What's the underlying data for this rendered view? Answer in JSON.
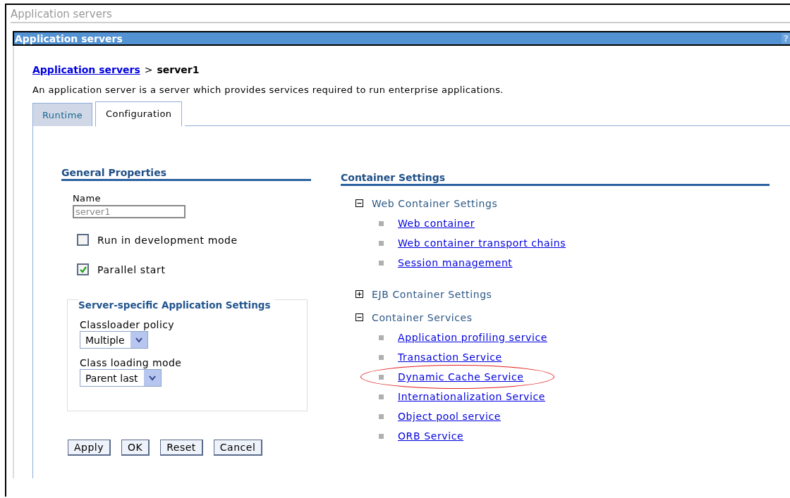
{
  "page_title": "Application servers",
  "panel": {
    "title": "Application servers",
    "help": "?"
  },
  "breadcrumb": {
    "link": "Application servers",
    "separator": ">",
    "current": "server1"
  },
  "description": "An application server is a server which provides services required to run enterprise applications.",
  "tabs": [
    {
      "label": "Runtime",
      "selected": false
    },
    {
      "label": "Configuration",
      "selected": true
    }
  ],
  "general_properties": {
    "heading": "General Properties",
    "name_field": {
      "label": "Name",
      "value": "server1",
      "disabled": true
    },
    "checkboxes": [
      {
        "label": "Run in development mode",
        "checked": false
      },
      {
        "label": "Parallel start",
        "checked": true
      }
    ],
    "fieldset": {
      "legend": "Server-specific Application Settings",
      "selects": [
        {
          "label": "Classloader policy",
          "value": "Multiple"
        },
        {
          "label": "Class loading mode",
          "value": "Parent last"
        }
      ]
    }
  },
  "buttons": [
    "Apply",
    "OK",
    "Reset",
    "Cancel"
  ],
  "container_settings": {
    "heading": "Container Settings",
    "groups": [
      {
        "label": "Web Container Settings",
        "expanded": true,
        "children": [
          {
            "label": "Web container",
            "highlighted": false
          },
          {
            "label": "Web container transport chains",
            "highlighted": false
          },
          {
            "label": "Session management",
            "highlighted": false
          }
        ]
      },
      {
        "label": "EJB Container Settings",
        "expanded": false
      },
      {
        "label": "Container Services",
        "expanded": true,
        "children": [
          {
            "label": "Application profiling service",
            "highlighted": false
          },
          {
            "label": "Transaction Service",
            "highlighted": false
          },
          {
            "label": "Dynamic Cache Service",
            "highlighted": true
          },
          {
            "label": "Internationalization Service",
            "highlighted": false
          },
          {
            "label": "Object pool service",
            "highlighted": false
          },
          {
            "label": "ORB Service",
            "highlighted": false
          }
        ]
      }
    ]
  }
}
